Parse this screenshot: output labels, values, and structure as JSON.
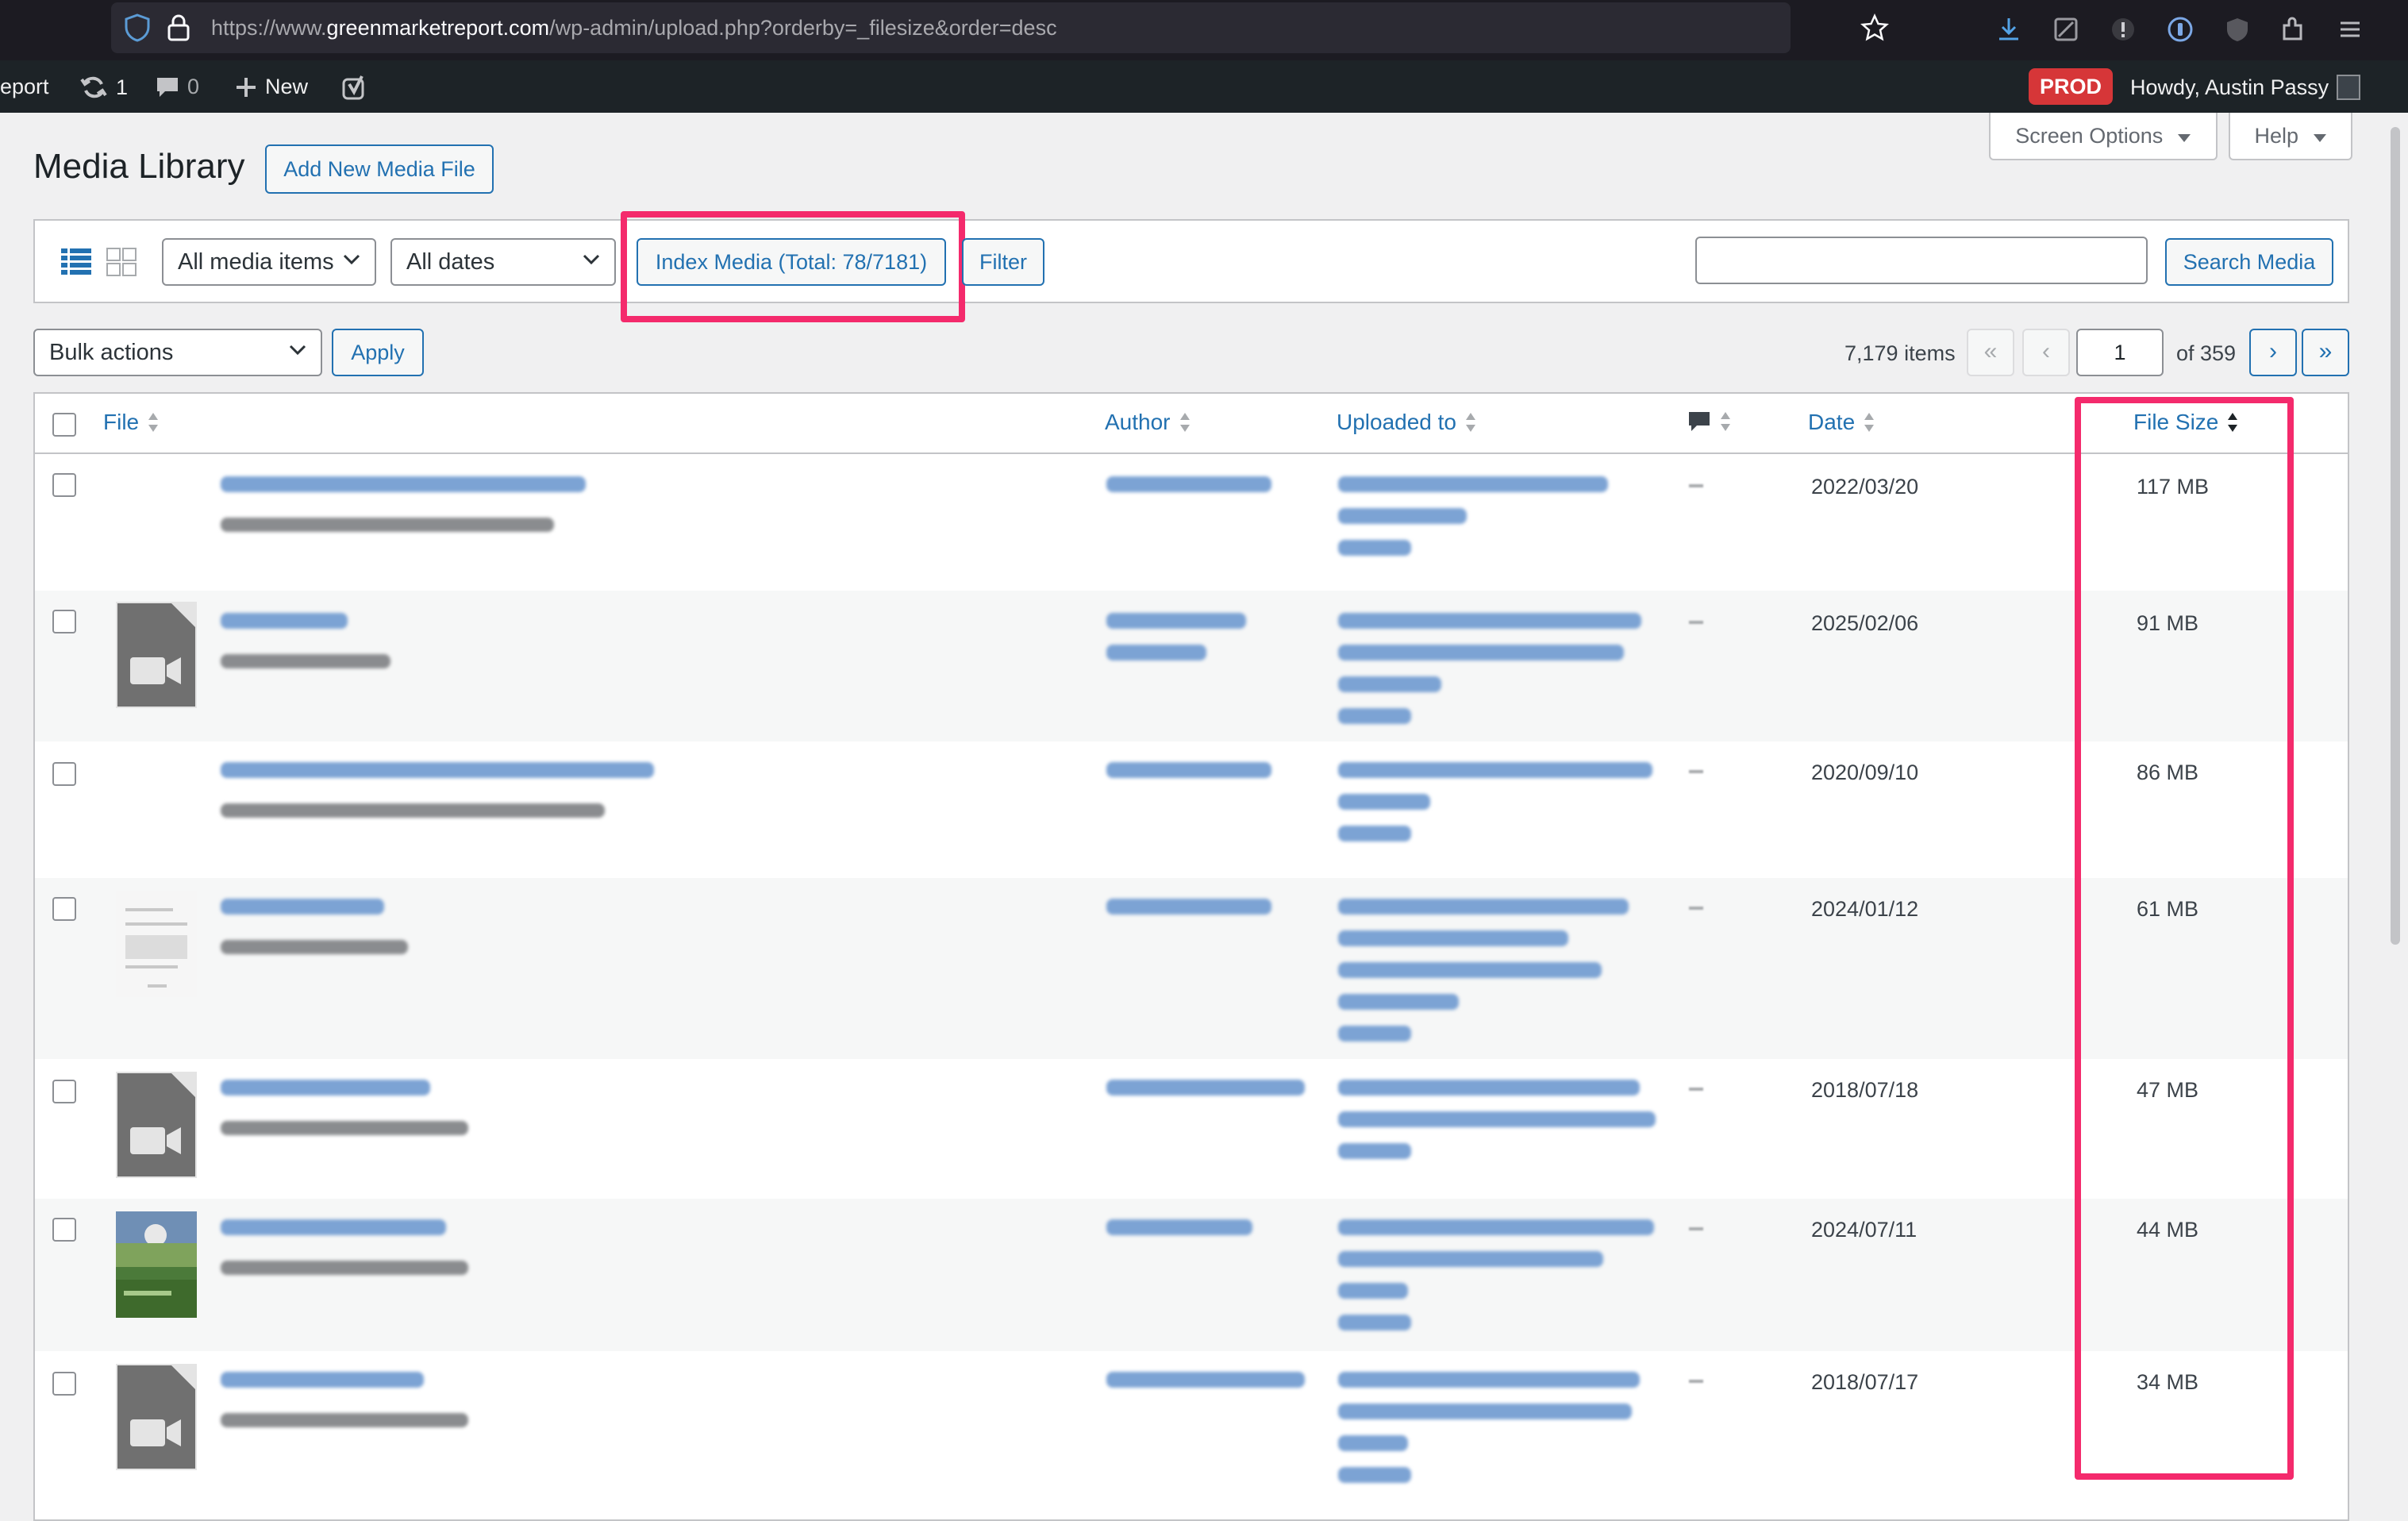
{
  "browser": {
    "url_prefix": "https://www.",
    "url_domain": "greenmarketreport.com",
    "url_path": "/wp-admin/upload.php?orderby=_filesize&order=desc"
  },
  "adminbar": {
    "site_name": "eport",
    "updates_count": "1",
    "comments_count": "0",
    "new_label": "New",
    "env_badge": "PROD",
    "greeting": "Howdy, Austin Passy"
  },
  "screen_options_label": "Screen Options",
  "help_label": "Help",
  "page": {
    "title": "Media Library",
    "add_new_label": "Add New Media File"
  },
  "filters": {
    "type_select": "All media items",
    "date_select": "All dates",
    "index_media_label": "Index Media (Total: 78/7181)",
    "filter_label": "Filter",
    "search_value": "",
    "search_button_label": "Search Media"
  },
  "bulk": {
    "select_label": "Bulk actions",
    "apply_label": "Apply"
  },
  "pagination": {
    "items_count": "7,179 items",
    "first": "«",
    "prev": "‹",
    "current_page": "1",
    "of_label": "of 359",
    "next": "›",
    "last": "»"
  },
  "table": {
    "columns": {
      "file": "File",
      "author": "Author",
      "uploaded_to": "Uploaded to",
      "date": "Date",
      "file_size": "File Size"
    },
    "rows": [
      {
        "thumb": "none",
        "date": "2022/03/20",
        "size": "117 MB"
      },
      {
        "thumb": "video-icon",
        "date": "2025/02/06",
        "size": "91 MB"
      },
      {
        "thumb": "none",
        "date": "2020/09/10",
        "size": "86 MB"
      },
      {
        "thumb": "document",
        "date": "2024/01/12",
        "size": "61 MB"
      },
      {
        "thumb": "video-icon",
        "date": "2018/07/18",
        "size": "47 MB"
      },
      {
        "thumb": "photo",
        "date": "2024/07/11",
        "size": "44 MB"
      },
      {
        "thumb": "video-icon",
        "date": "2018/07/17",
        "size": "34 MB"
      }
    ]
  },
  "colors": {
    "wp_blue": "#2271b1",
    "highlight": "#f42a6c",
    "admin_bar": "#1d2327",
    "prod_red": "#d63638"
  }
}
